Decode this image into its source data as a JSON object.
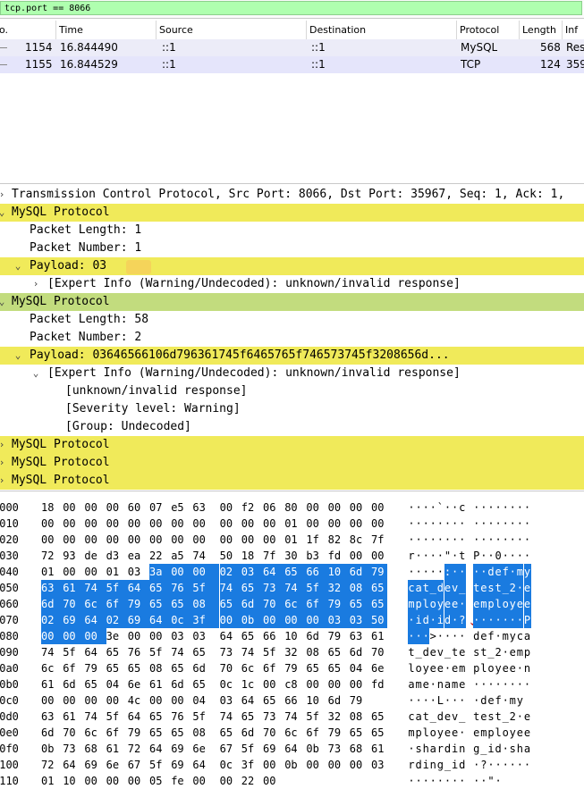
{
  "filter": {
    "value": "tcp.port == 8066"
  },
  "packet_list": {
    "columns": [
      "o.",
      "Time",
      "Source",
      "Destination",
      "Protocol",
      "Length",
      "Inf"
    ],
    "rows": [
      {
        "no": "1154",
        "time": "16.844490",
        "source": "::1",
        "destination": "::1",
        "protocol": "MySQL",
        "length": "568",
        "info": "Res"
      },
      {
        "no": "1155",
        "time": "16.844529",
        "source": "::1",
        "destination": "::1",
        "protocol": "TCP",
        "length": "124",
        "info": "359"
      }
    ]
  },
  "tree": {
    "rows": [
      {
        "text": "Transmission Control Protocol, Src Port: 8066, Dst Port: 35967, Seq: 1, Ack: 1,"
      },
      {
        "text": "MySQL Protocol"
      },
      {
        "text": "Packet Length: 1"
      },
      {
        "text": "Packet Number: 1"
      },
      {
        "text": "Payload: 03"
      },
      {
        "text": "[Expert Info (Warning/Undecoded): unknown/invalid response]"
      },
      {
        "text": "MySQL Protocol"
      },
      {
        "text": "Packet Length: 58"
      },
      {
        "text": "Packet Number: 2"
      },
      {
        "text": "Payload: 03646566106d796361745f6465765f746573745f3208656d..."
      },
      {
        "text": "[Expert Info (Warning/Undecoded): unknown/invalid response]"
      },
      {
        "text": "[unknown/invalid response]"
      },
      {
        "text": "[Severity level: Warning]"
      },
      {
        "text": "[Group: Undecoded]"
      },
      {
        "text": "MySQL Protocol"
      },
      {
        "text": "MySQL Protocol"
      },
      {
        "text": "MySQL Protocol"
      }
    ]
  },
  "hex": {
    "rows": [
      {
        "off": "0000",
        "bytes": [
          "18",
          "00",
          "00",
          "00",
          "60",
          "07",
          "e5",
          "63",
          "00",
          "f2",
          "06",
          "80",
          "00",
          "00",
          "00",
          "00"
        ],
        "ascii": "····`··c········"
      },
      {
        "off": "0010",
        "bytes": [
          "00",
          "00",
          "00",
          "00",
          "00",
          "00",
          "00",
          "00",
          "00",
          "00",
          "00",
          "01",
          "00",
          "00",
          "00",
          "00"
        ],
        "ascii": "················"
      },
      {
        "off": "0020",
        "bytes": [
          "00",
          "00",
          "00",
          "00",
          "00",
          "00",
          "00",
          "00",
          "00",
          "00",
          "00",
          "01",
          "1f",
          "82",
          "8c",
          "7f"
        ],
        "ascii": "················"
      },
      {
        "off": "0030",
        "bytes": [
          "72",
          "93",
          "de",
          "d3",
          "ea",
          "22",
          "a5",
          "74",
          "50",
          "18",
          "7f",
          "30",
          "b3",
          "fd",
          "00",
          "00"
        ],
        "ascii": "r····\"·tP··0····"
      },
      {
        "off": "0040",
        "bytes": [
          "01",
          "00",
          "00",
          "01",
          "03",
          "3a",
          "00",
          "00",
          "02",
          "03",
          "64",
          "65",
          "66",
          "10",
          "6d",
          "79"
        ],
        "ascii": "·····:····def·my"
      },
      {
        "off": "0050",
        "bytes": [
          "63",
          "61",
          "74",
          "5f",
          "64",
          "65",
          "76",
          "5f",
          "74",
          "65",
          "73",
          "74",
          "5f",
          "32",
          "08",
          "65"
        ],
        "ascii": "cat_dev_test_2·e"
      },
      {
        "off": "0060",
        "bytes": [
          "6d",
          "70",
          "6c",
          "6f",
          "79",
          "65",
          "65",
          "08",
          "65",
          "6d",
          "70",
          "6c",
          "6f",
          "79",
          "65",
          "65"
        ],
        "ascii": "mployee·employee"
      },
      {
        "off": "0070",
        "bytes": [
          "02",
          "69",
          "64",
          "02",
          "69",
          "64",
          "0c",
          "3f",
          "00",
          "0b",
          "00",
          "00",
          "00",
          "03",
          "03",
          "50"
        ],
        "ascii": "·id·id·?·······P"
      },
      {
        "off": "0080",
        "bytes": [
          "00",
          "00",
          "00",
          "3e",
          "00",
          "00",
          "03",
          "03",
          "64",
          "65",
          "66",
          "10",
          "6d",
          "79",
          "63",
          "61"
        ],
        "ascii": "···>····def·myca"
      },
      {
        "off": "0090",
        "bytes": [
          "74",
          "5f",
          "64",
          "65",
          "76",
          "5f",
          "74",
          "65",
          "73",
          "74",
          "5f",
          "32",
          "08",
          "65",
          "6d",
          "70"
        ],
        "ascii": "t_dev_test_2·emp"
      },
      {
        "off": "00a0",
        "bytes": [
          "6c",
          "6f",
          "79",
          "65",
          "65",
          "08",
          "65",
          "6d",
          "70",
          "6c",
          "6f",
          "79",
          "65",
          "65",
          "04",
          "6e"
        ],
        "ascii": "loyee·employee·n"
      },
      {
        "off": "00b0",
        "bytes": [
          "61",
          "6d",
          "65",
          "04",
          "6e",
          "61",
          "6d",
          "65",
          "0c",
          "1c",
          "00",
          "c8",
          "00",
          "00",
          "00",
          "fd"
        ],
        "ascii": "ame·name········"
      },
      {
        "off": "00c0",
        "bytes": [
          "00",
          "00",
          "00",
          "00",
          "4c",
          "00",
          "00",
          "04",
          "03",
          "64",
          "65",
          "66",
          "10",
          "6d",
          "79"
        ],
        "ascii": "····L····def·my"
      },
      {
        "off": "00d0",
        "bytes": [
          "63",
          "61",
          "74",
          "5f",
          "64",
          "65",
          "76",
          "5f",
          "74",
          "65",
          "73",
          "74",
          "5f",
          "32",
          "08",
          "65"
        ],
        "ascii": "cat_dev_test_2·e"
      },
      {
        "off": "00e0",
        "bytes": [
          "6d",
          "70",
          "6c",
          "6f",
          "79",
          "65",
          "65",
          "08",
          "65",
          "6d",
          "70",
          "6c",
          "6f",
          "79",
          "65",
          "65"
        ],
        "ascii": "mployee·employee"
      },
      {
        "off": "00f0",
        "bytes": [
          "0b",
          "73",
          "68",
          "61",
          "72",
          "64",
          "69",
          "6e",
          "67",
          "5f",
          "69",
          "64",
          "0b",
          "73",
          "68",
          "61"
        ],
        "ascii": "·sharding_id·sha"
      },
      {
        "off": "0100",
        "bytes": [
          "72",
          "64",
          "69",
          "6e",
          "67",
          "5f",
          "69",
          "64",
          "0c",
          "3f",
          "00",
          "0b",
          "00",
          "00",
          "00",
          "03"
        ],
        "ascii": "rding_id·?······"
      },
      {
        "off": "0110",
        "bytes": [
          "01",
          "10",
          "00",
          "00",
          "00",
          "05",
          "fe",
          "00",
          "00",
          "22",
          "00"
        ],
        "ascii": "··········\"·"
      }
    ],
    "highlight": {
      "start": 69,
      "end": 130
    }
  }
}
